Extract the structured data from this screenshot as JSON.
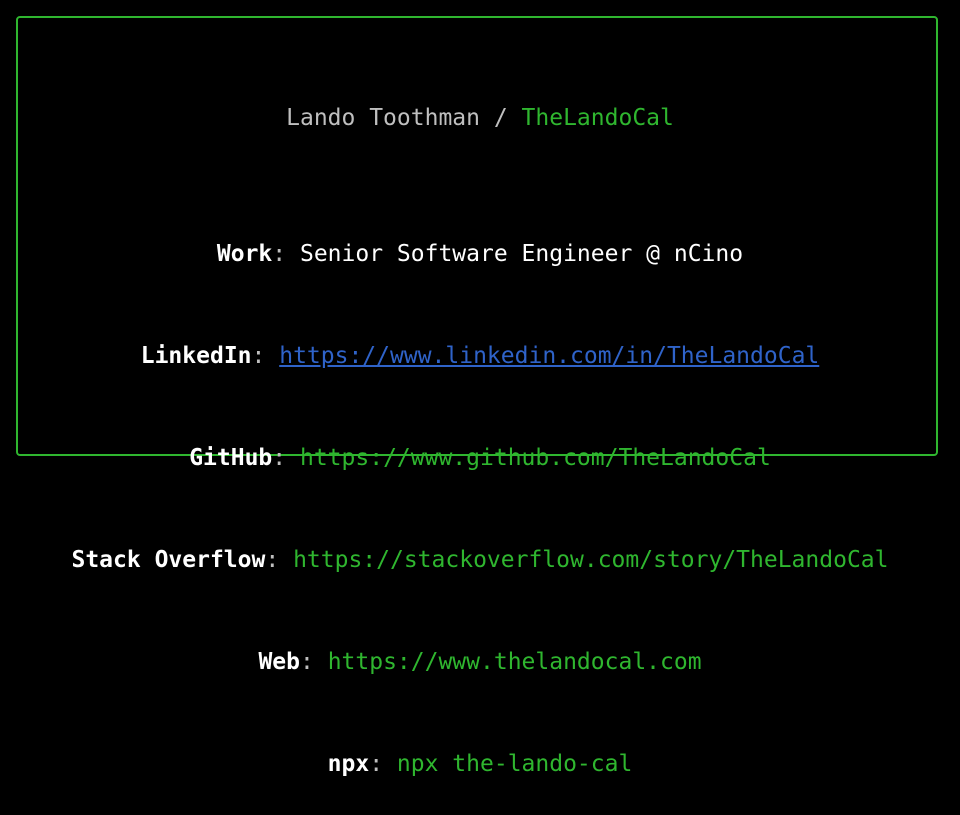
{
  "header": {
    "name": "Lando Toothman",
    "separator": " / ",
    "handle": "TheLandoCal"
  },
  "colors": {
    "border": "#2fb62f",
    "green": "#2fb62f",
    "link": "#2f63c9",
    "dim": "#bfbfbf",
    "background": "#000000"
  },
  "rows": [
    {
      "label": "Work",
      "sep": ": ",
      "value": "Senior Software Engineer @ nCino"
    },
    {
      "label": "LinkedIn",
      "sep": ": ",
      "value": "https://www.linkedin.com/in/TheLandoCal"
    },
    {
      "label": "GitHub",
      "sep": ": ",
      "value": "https://www.github.com/TheLandoCal"
    },
    {
      "label": "Stack Overflow",
      "sep": ": ",
      "value": "https://stackoverflow.com/story/TheLandoCal"
    },
    {
      "label": "Web",
      "sep": ": ",
      "value": "https://www.thelandocal.com"
    },
    {
      "label": "npx",
      "sep": ": ",
      "value": "npx the-lando-cal"
    }
  ]
}
